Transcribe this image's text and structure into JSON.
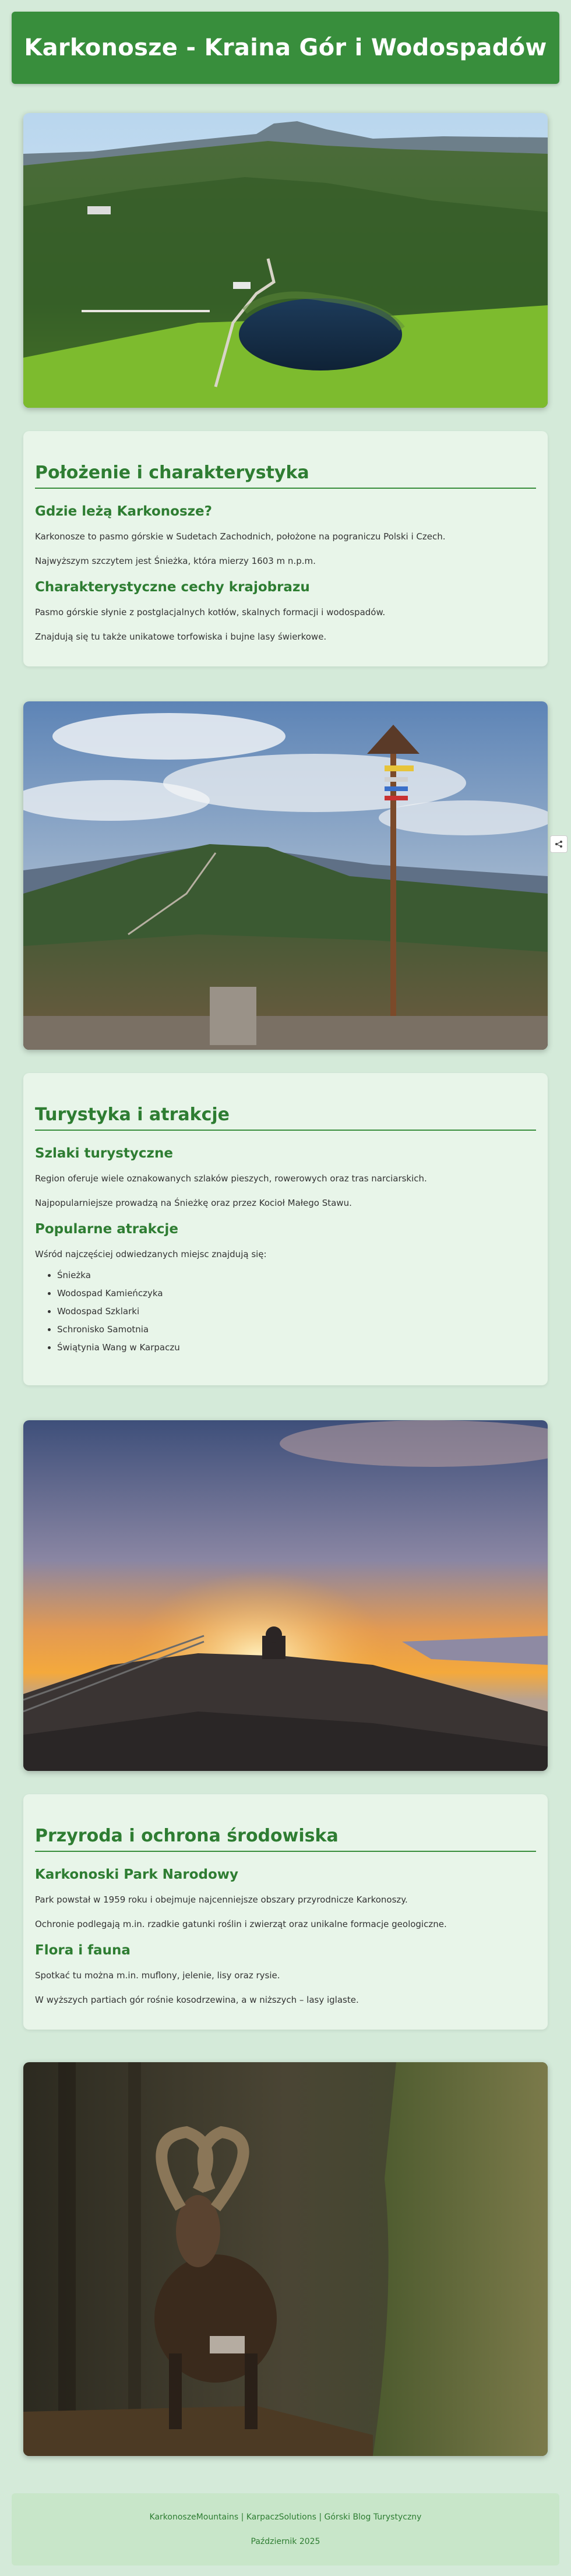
{
  "header": {
    "title": "Karkonosze - Kraina Gór i Wodospadów"
  },
  "sections": [
    {
      "title": "Położenie i charakterystyka",
      "blocks": [
        {
          "heading": "Gdzie leżą Karkonosze?",
          "paragraphs": [
            "Karkonosze to pasmo górskie w Sudetach Zachodnich, położone na pograniczu Polski i Czech.",
            "Najwyższym szczytem jest Śnieżka, która mierzy 1603 m n.p.m."
          ]
        },
        {
          "heading": "Charakterystyczne cechy krajobrazu",
          "paragraphs": [
            "Pasmo górskie słynie z postglacjalnych kotłów, skalnych formacji i wodospadów.",
            "Znajdują się tu także unikatowe torfowiska i bujne lasy świerkowe."
          ]
        }
      ]
    },
    {
      "title": "Turystyka i atrakcje",
      "blocks": [
        {
          "heading": "Szlaki turystyczne",
          "paragraphs": [
            "Region oferuje wiele oznakowanych szlaków pieszych, rowerowych oraz tras narciarskich.",
            "Najpopularniejsze prowadzą na Śnieżkę oraz przez Kocioł Małego Stawu."
          ]
        },
        {
          "heading": "Popularne atrakcje",
          "paragraphs": [
            "Wśród najczęściej odwiedzanych miejsc znajdują się:"
          ],
          "list": [
            "Śnieżka",
            "Wodospad Kamieńczyka",
            "Wodospad Szklarki",
            "Schronisko Samotnia",
            "Świątynia Wang w Karpaczu"
          ]
        }
      ]
    },
    {
      "title": "Przyroda i ochrona środowiska",
      "blocks": [
        {
          "heading": "Karkonoski Park Narodowy",
          "paragraphs": [
            "Park powstał w 1959 roku i obejmuje najcenniejsze obszary przyrodnicze Karkonoszy.",
            "Ochronie podlegają m.in. rzadkie gatunki roślin i zwierząt oraz unikalne formacje geologiczne."
          ]
        },
        {
          "heading": "Flora i fauna",
          "paragraphs": [
            "Spotkać tu można m.in. muflony, jelenie, lisy oraz rysie.",
            "W wyższych partiach gór rośnie kosodrzewina, a w niższych – lasy iglaste."
          ]
        }
      ]
    }
  ],
  "footer": {
    "line1": "KarkonoszeMountains | KarpaczSolutions | Górski Blog Turystyczny",
    "line2": "Październik 2025"
  },
  "icons": {
    "share": "share-icon"
  },
  "colors": {
    "header_bg": "#388e3c",
    "page_bg": "#d4ead9",
    "section_bg": "#e8f5e9",
    "heading": "#2e7d32",
    "footer_bg": "#c8e6c9"
  }
}
